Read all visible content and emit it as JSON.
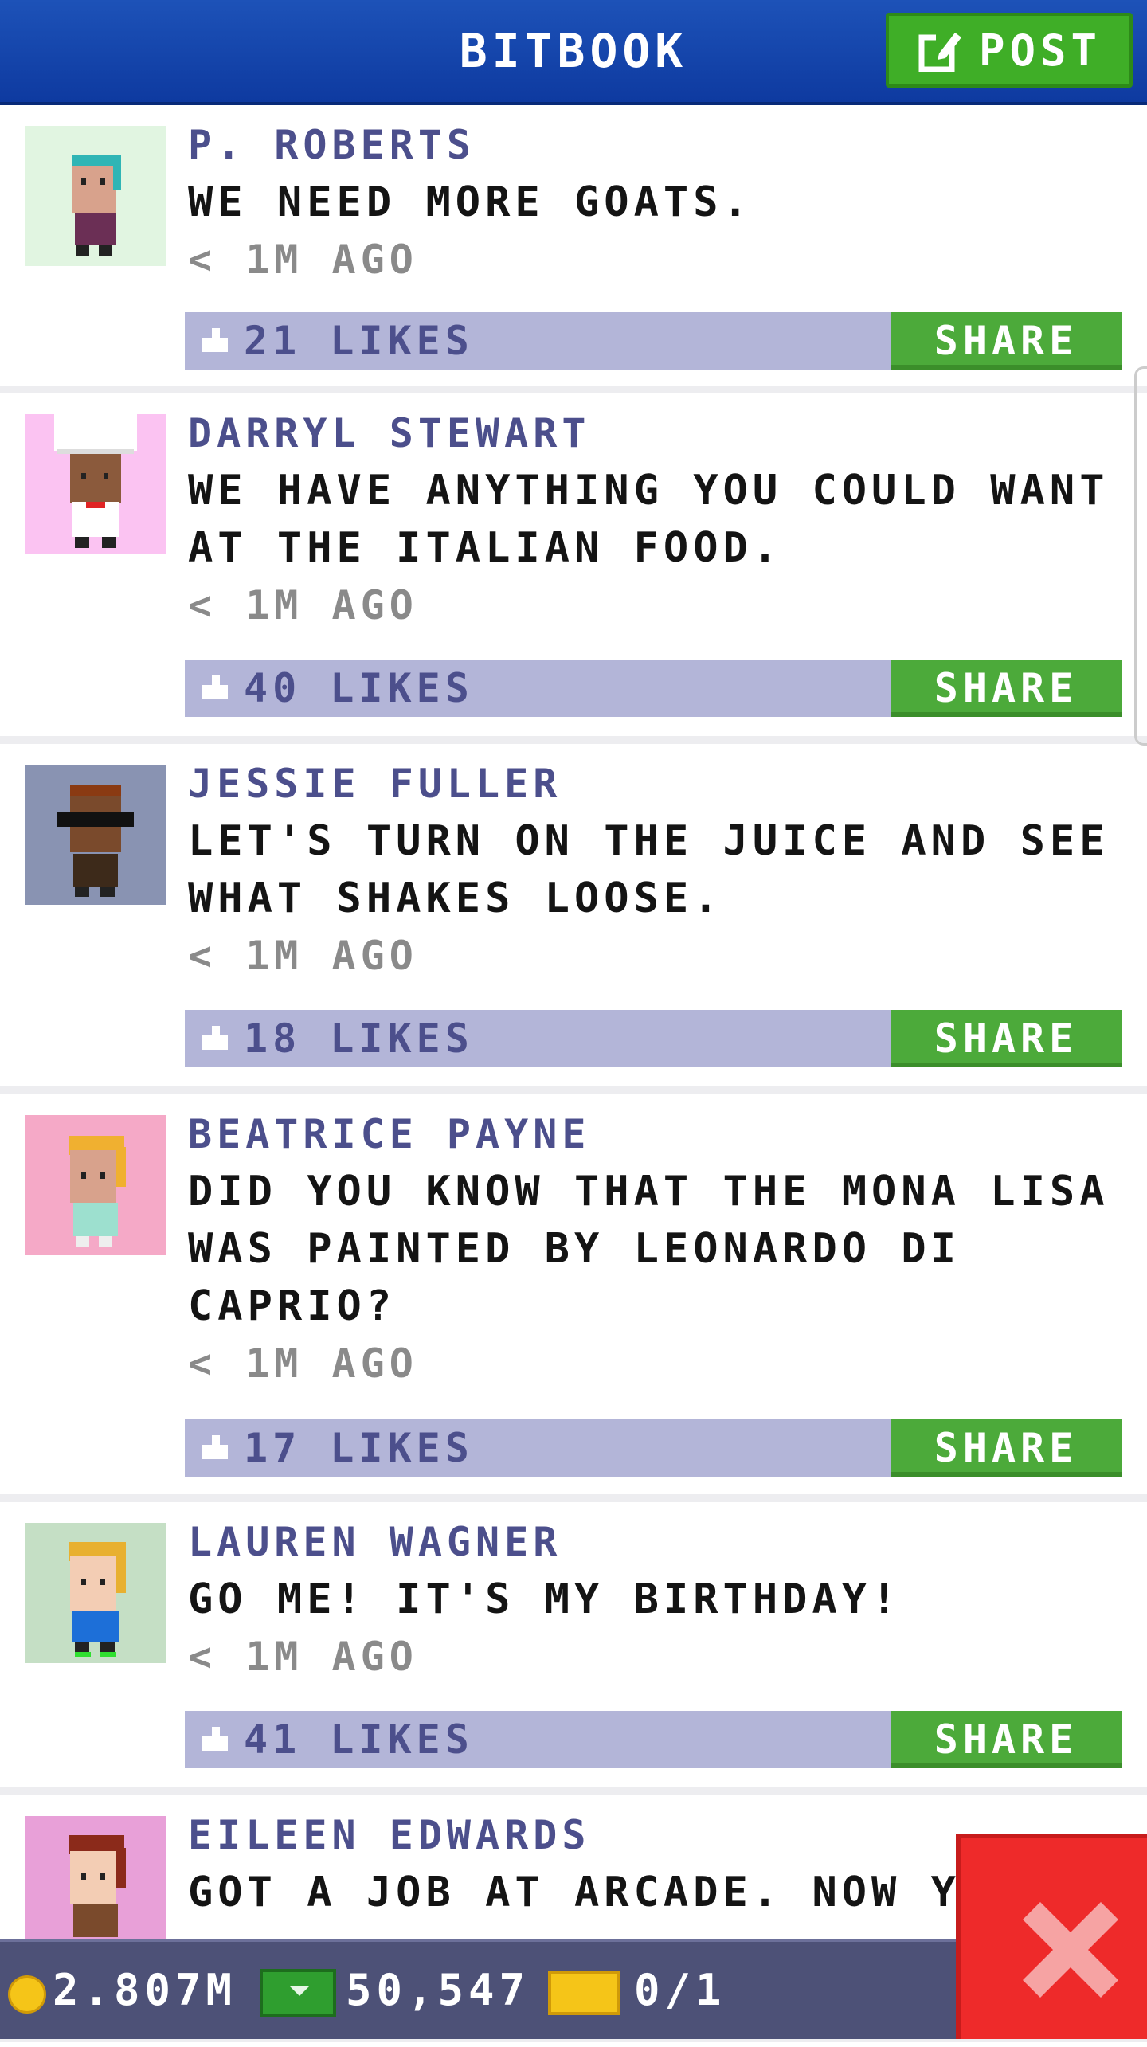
{
  "header": {
    "title": "BITBOOK",
    "post_label": "POST"
  },
  "posts": [
    {
      "author": "P. ROBERTS",
      "message": "WE NEED MORE GOATS.",
      "time": "< 1M AGO",
      "likes": "21 LIKES",
      "share": "SHARE",
      "avatar_bg": "#e1f5e1"
    },
    {
      "author": "DARRYL STEWART",
      "message": "WE HAVE ANYTHING YOU COULD WANT AT THE ITALIAN FOOD.",
      "time": "< 1M AGO",
      "likes": "40 LIKES",
      "share": "SHARE",
      "avatar_bg": "#fbc3f2"
    },
    {
      "author": "JESSIE FULLER",
      "message": "LET'S TURN ON THE JUICE AND SEE WHAT SHAKES LOOSE.",
      "time": "< 1M AGO",
      "likes": "18 LIKES",
      "share": "SHARE",
      "avatar_bg": "#8993b2"
    },
    {
      "author": "BEATRICE PAYNE",
      "message": "DID YOU KNOW THAT THE MONA LISA WAS PAINTED BY LEONARDO DI CAPRIO?",
      "time": "< 1M AGO",
      "likes": "17 LIKES",
      "share": "SHARE",
      "avatar_bg": "#f5a9c7"
    },
    {
      "author": "LAUREN WAGNER",
      "message": "GO ME! IT'S MY BIRTHDAY!",
      "time": "< 1M AGO",
      "likes": "41 LIKES",
      "share": "SHARE",
      "avatar_bg": "#c5dfc5"
    },
    {
      "author": "EILEEN EDWARDS",
      "message": "GOT A JOB AT ARCADE. NOW YO",
      "time": "",
      "likes": "",
      "share": "",
      "avatar_bg": "#e8a0d8"
    }
  ],
  "stats": {
    "coins": "2.807M",
    "cash": "50,547",
    "tickets": "0/1"
  }
}
